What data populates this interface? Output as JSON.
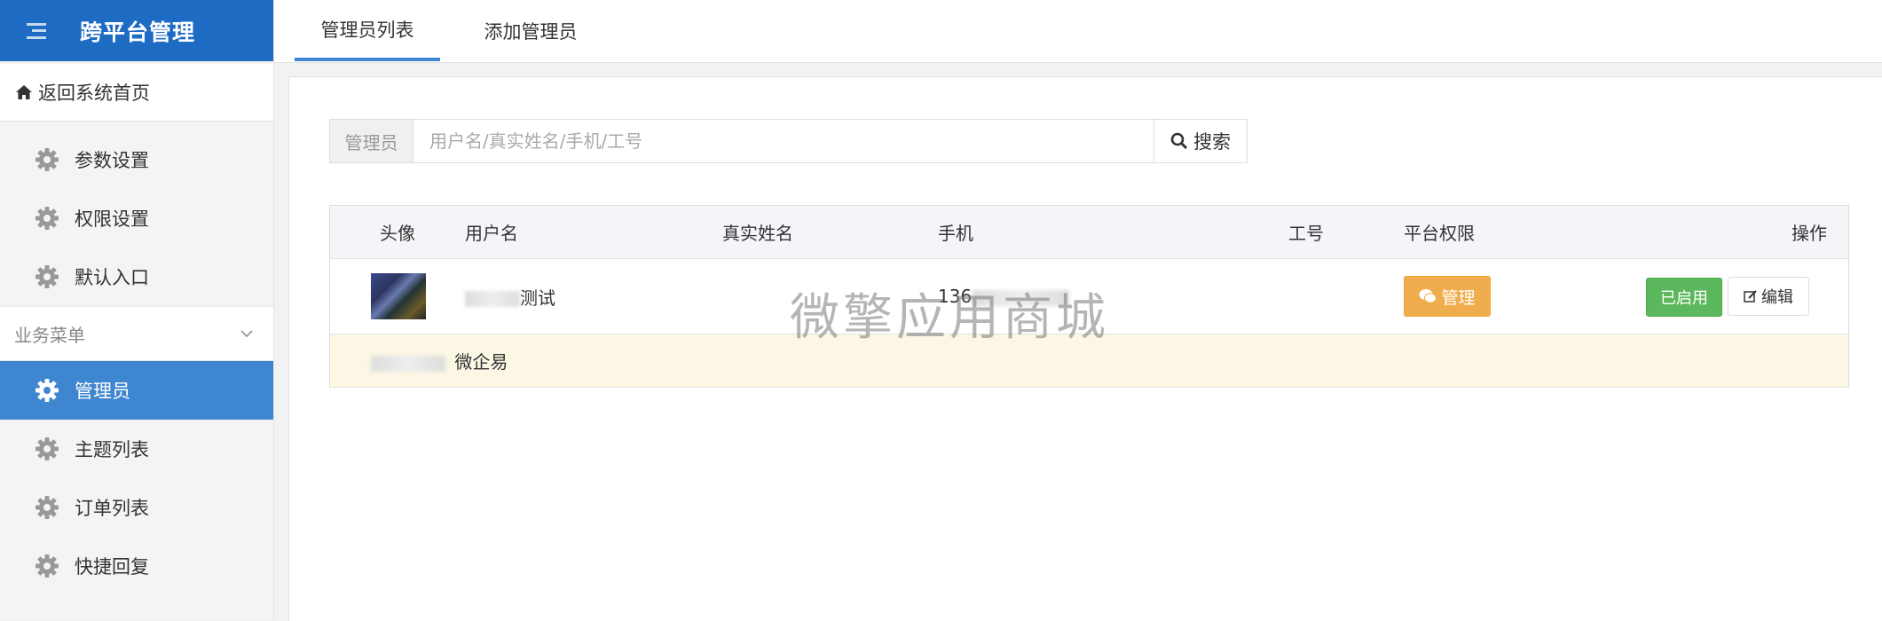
{
  "app": {
    "title": "跨平台管理"
  },
  "sidebar": {
    "back_home": "返回系统首页",
    "items_top": [
      {
        "label": "参数设置"
      },
      {
        "label": "权限设置"
      },
      {
        "label": "默认入口"
      }
    ],
    "section_title": "业务菜单",
    "items_business": [
      {
        "label": "管理员",
        "active": true
      },
      {
        "label": "主题列表"
      },
      {
        "label": "订单列表"
      },
      {
        "label": "快捷回复"
      }
    ]
  },
  "tabs": [
    {
      "label": "管理员列表",
      "active": true
    },
    {
      "label": "添加管理员"
    }
  ],
  "search": {
    "addon_label": "管理员",
    "placeholder": "用户名/真实姓名/手机/工号",
    "button_label": "搜索"
  },
  "table": {
    "headers": {
      "avatar": "头像",
      "username": "用户名",
      "realname": "真实姓名",
      "phone": "手机",
      "employee_no": "工号",
      "platform_perm": "平台权限",
      "actions": "操作"
    },
    "rows": [
      {
        "username_visible": "测试",
        "realname": "",
        "phone_visible": "136",
        "employee_no": "",
        "manage_label": "管理",
        "status_label": "已启用",
        "edit_label": "编辑",
        "sub_text": "微企易"
      }
    ]
  },
  "watermark": "微擎应用商城",
  "colors": {
    "brand": "#1e6bc4",
    "active_nav": "#3e86cf",
    "manage_button": "#f0ad4e",
    "enabled_button": "#5cb85c",
    "sub_row_bg": "#fcf7e4"
  }
}
